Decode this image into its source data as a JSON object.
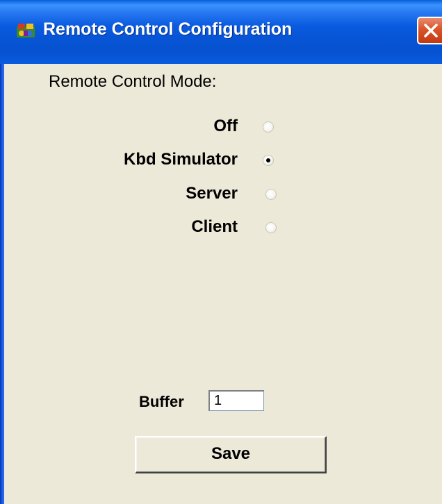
{
  "window": {
    "title": "Remote Control Configuration",
    "icon": "app-icon"
  },
  "mode": {
    "label": "Remote Control Mode:",
    "options": [
      {
        "label": "Off",
        "selected": false
      },
      {
        "label": "Kbd Simulator",
        "selected": true
      },
      {
        "label": "Server",
        "selected": false
      },
      {
        "label": "Client",
        "selected": false
      }
    ]
  },
  "buffer": {
    "label": "Buffer",
    "value": "1"
  },
  "actions": {
    "save_label": "Save"
  },
  "colors": {
    "titlebar": "#0a5be0",
    "background": "#ece9d8",
    "close": "#d9532b"
  }
}
